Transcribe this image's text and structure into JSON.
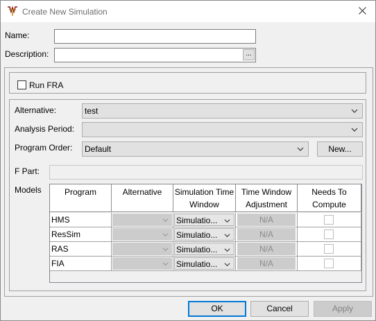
{
  "window": {
    "title": "Create New Simulation"
  },
  "form": {
    "name_label": "Name:",
    "name_value": "",
    "description_label": "Description:",
    "description_value": "",
    "description_button": "..."
  },
  "run_fra": {
    "label": "Run FRA",
    "checked": false
  },
  "alternative": {
    "label": "Alternative:",
    "value": "test"
  },
  "analysis_period": {
    "label": "Analysis Period:",
    "value": ""
  },
  "program_order": {
    "label": "Program Order:",
    "value": "Default",
    "new_button": "New..."
  },
  "f_part": {
    "label": "F Part:",
    "value": ""
  },
  "models": {
    "label": "Models",
    "columns": [
      "Program",
      "Alternative",
      "Simulation Time Window",
      "Time Window Adjustment",
      "Needs To Compute"
    ],
    "rows": [
      {
        "program": "HMS",
        "alternative": "",
        "time_window": "Simulatio...",
        "adjustment": "N/A",
        "needs_compute": false
      },
      {
        "program": "ResSim",
        "alternative": "",
        "time_window": "Simulatio...",
        "adjustment": "N/A",
        "needs_compute": false
      },
      {
        "program": "RAS",
        "alternative": "",
        "time_window": "Simulatio...",
        "adjustment": "N/A",
        "needs_compute": false
      },
      {
        "program": "FIA",
        "alternative": "",
        "time_window": "Simulatio...",
        "adjustment": "N/A",
        "needs_compute": false
      }
    ]
  },
  "buttons": {
    "ok": "OK",
    "cancel": "Cancel",
    "apply": "Apply"
  },
  "colors": {
    "accent": "#0078d7",
    "disabled_cell": "#cccccc",
    "app_icon": "#b8860b"
  },
  "icons": [
    "app-logo-icon",
    "close-icon",
    "chevron-down-icon",
    "checkbox"
  ]
}
